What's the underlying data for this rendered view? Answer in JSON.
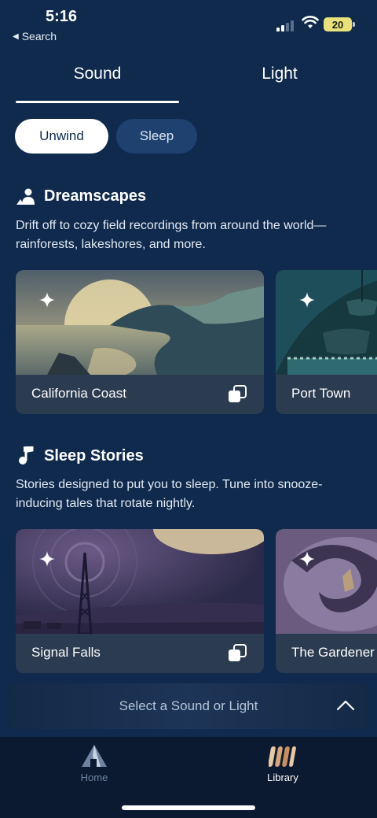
{
  "status_bar": {
    "time": "5:16",
    "back_label": "Search",
    "battery": "20"
  },
  "tabs": [
    {
      "label": "Sound",
      "selected": true
    },
    {
      "label": "Light",
      "selected": false
    }
  ],
  "segments": [
    {
      "label": "Unwind",
      "selected": true
    },
    {
      "label": "Sleep",
      "selected": false
    }
  ],
  "dreamscapes": {
    "icon": "person-landscape-icon",
    "title": "Dreamscapes",
    "description": "Drift off to cozy field recordings from around the world—rainforests, lakeshores, and more.",
    "cards": [
      {
        "label": "California Coast",
        "icon": "stack-icon"
      },
      {
        "label": "Port Town"
      }
    ]
  },
  "sleep_stories": {
    "icon": "music-note-icon",
    "title": "Sleep Stories",
    "description": "Stories designed to put you to sleep. Tune into snooze-inducing tales that rotate nightly.",
    "cards": [
      {
        "label": "Signal Falls",
        "icon": "stack-icon"
      },
      {
        "label": "The Gardener"
      }
    ]
  },
  "player": {
    "placeholder": "Select a Sound or Light"
  },
  "nav": [
    {
      "label": "Home",
      "icon": "home-icon",
      "selected": false
    },
    {
      "label": "Library",
      "icon": "library-icon",
      "selected": true
    }
  ],
  "colors": {
    "background": "#0f2a4d",
    "caption": "#2b3b50",
    "active_segment": "#ffffff",
    "inactive_segment": "#1f4170",
    "battery": "#e9e27a"
  }
}
